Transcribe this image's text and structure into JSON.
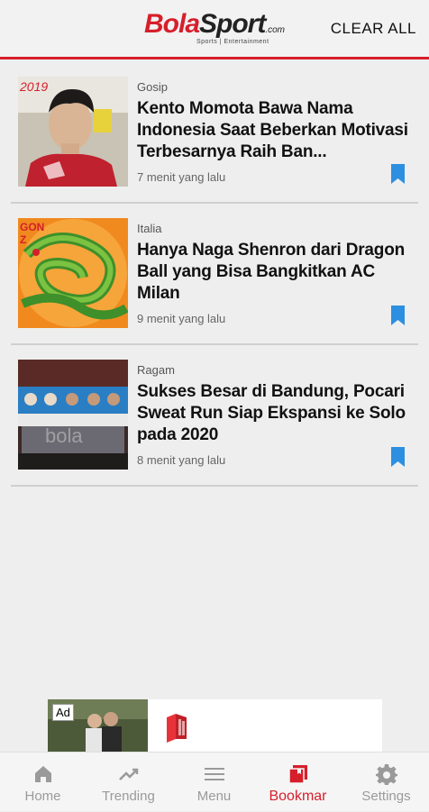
{
  "header": {
    "logo_bola": "Bola",
    "logo_sport": "Sport",
    "logo_com": ".com",
    "logo_tagline": "Sports | Entertainment",
    "clear_all_label": "CLEAR ALL",
    "brand_color": "#d61f2b"
  },
  "articles": [
    {
      "category": "Gosip",
      "title": "Kento Momota Bawa Nama Indonesia Saat Beberkan Motivasi Terbesarnya Raih Ban...",
      "time": "7 menit yang lalu",
      "thumb_text": "2019"
    },
    {
      "category": "Italia",
      "title": "Hanya Naga Shenron dari Dragon Ball yang Bisa Bangkitkan AC Milan",
      "time": "9 menit yang lalu",
      "thumb_text": "GON\nZ"
    },
    {
      "category": "Ragam",
      "title": "Sukses Besar di Bandung, Pocari Sweat Run Siap Ekspansi ke Solo pada 2020",
      "time": "8 menit yang lalu",
      "thumb_text": "bola"
    }
  ],
  "ad": {
    "badge": "Ad"
  },
  "nav": {
    "items": [
      {
        "label": "Home",
        "icon": "home-icon"
      },
      {
        "label": "Trending",
        "icon": "trending-icon"
      },
      {
        "label": "Menu",
        "icon": "menu-icon"
      },
      {
        "label": "Bookmar",
        "icon": "bookmark-icon"
      },
      {
        "label": "Settings",
        "icon": "settings-icon"
      }
    ],
    "active_index": 3
  },
  "colors": {
    "accent": "#d61f2b",
    "bookmark": "#2d8fe0"
  }
}
